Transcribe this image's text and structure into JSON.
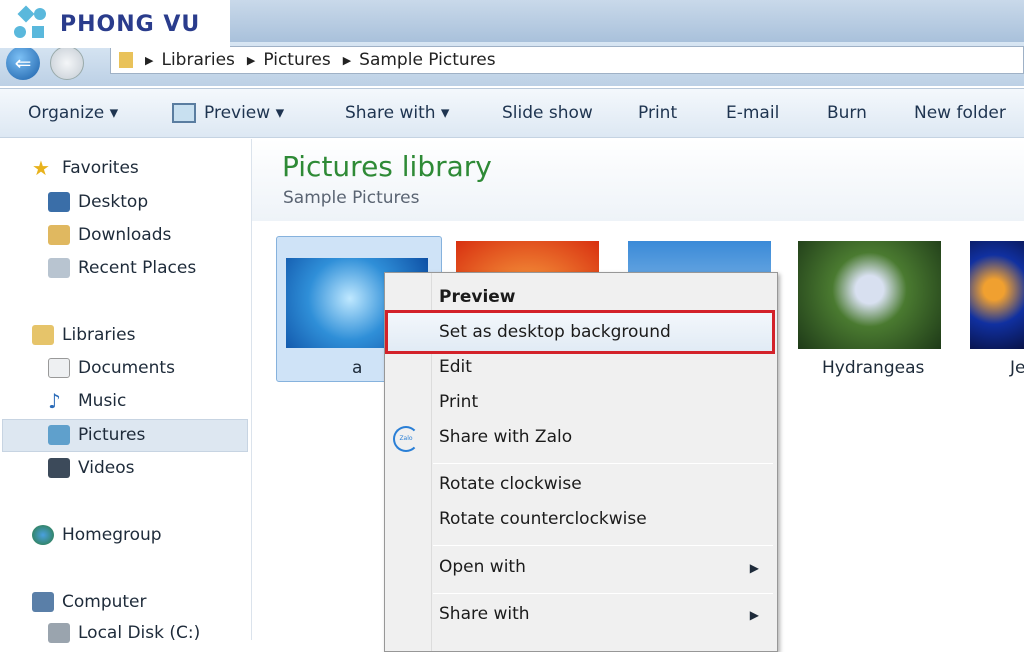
{
  "watermark": "PHONG VU",
  "address": {
    "crumbs": [
      "Libraries",
      "Pictures",
      "Sample Pictures"
    ]
  },
  "toolbar": {
    "organize": "Organize ▾",
    "preview": "Preview ▾",
    "share_with": "Share with ▾",
    "slide_show": "Slide show",
    "print": "Print",
    "email": "E-mail",
    "burn": "Burn",
    "new_folder": "New folder"
  },
  "sidebar": {
    "favorites": "Favorites",
    "desktop": "Desktop",
    "downloads": "Downloads",
    "recent": "Recent Places",
    "libraries": "Libraries",
    "documents": "Documents",
    "music": "Music",
    "pictures": "Pictures",
    "videos": "Videos",
    "homegroup": "Homegroup",
    "computer": "Computer",
    "local_disk": "Local Disk (C:)"
  },
  "main": {
    "title": "Pictures library",
    "subtitle": "Sample Pictures",
    "items": [
      {
        "name": "a"
      },
      {
        "name": ""
      },
      {
        "name": ""
      },
      {
        "name": "Hydrangeas"
      },
      {
        "name": "Je"
      }
    ]
  },
  "context_menu": {
    "preview": "Preview",
    "set_bg": "Set as desktop background",
    "edit": "Edit",
    "print": "Print",
    "share_zalo": "Share with Zalo",
    "zalo_icon_text": "Zalo",
    "rotate_cw": "Rotate clockwise",
    "rotate_ccw": "Rotate counterclockwise",
    "open_with": "Open with",
    "share_with": "Share with"
  },
  "colors": {
    "highlight_border": "#d3222a",
    "title_green": "#2e8a36"
  }
}
